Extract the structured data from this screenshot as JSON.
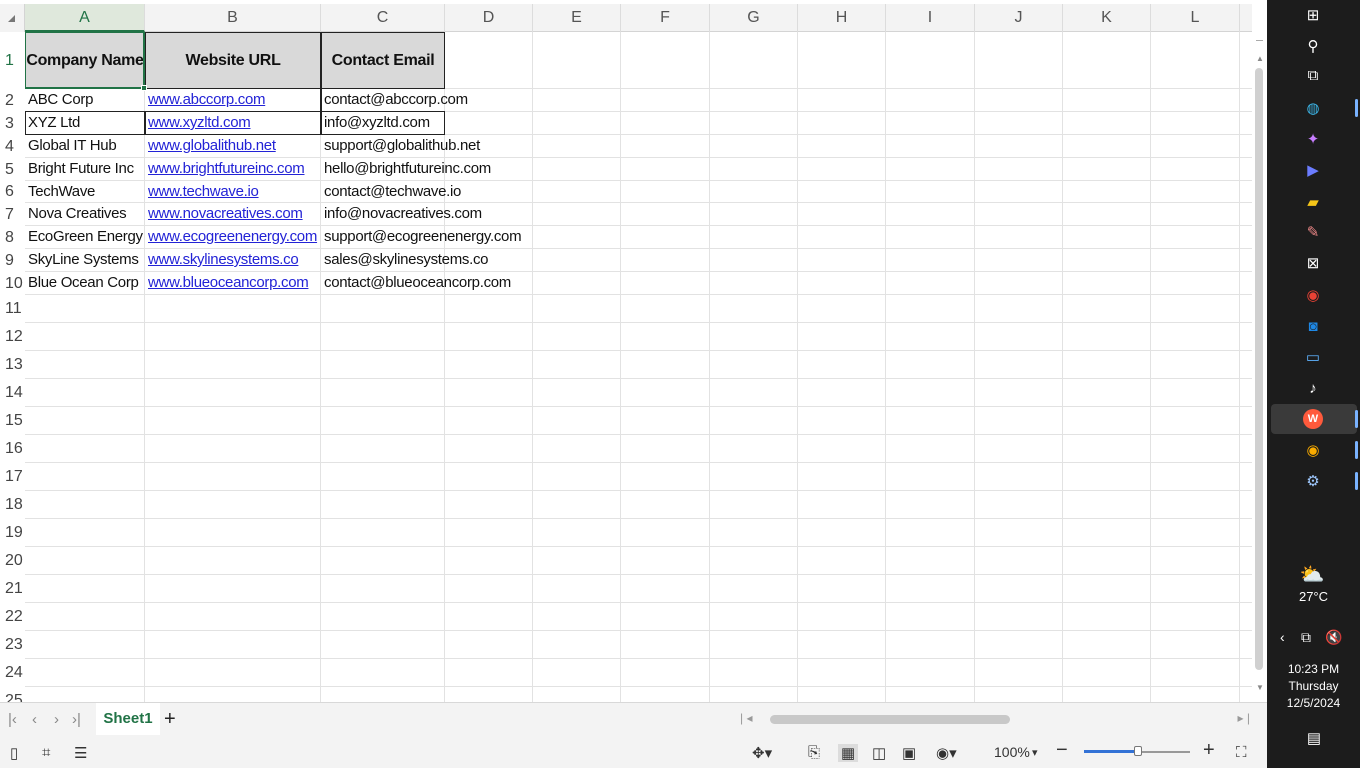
{
  "columns": [
    "A",
    "B",
    "C",
    "D",
    "E",
    "F",
    "G",
    "H",
    "I",
    "J",
    "K",
    "L"
  ],
  "rows": [
    "1",
    "2",
    "3",
    "4",
    "5",
    "6",
    "7",
    "8",
    "9",
    "10",
    "11",
    "12",
    "13",
    "14",
    "15",
    "16",
    "17",
    "18",
    "19",
    "20",
    "21",
    "22",
    "23",
    "24",
    "25"
  ],
  "headers": {
    "company": "Company Name",
    "website": "Website URL",
    "email": "Contact Email"
  },
  "records": [
    {
      "company": "ABC Corp",
      "website": "www.abccorp.com",
      "email": "contact@abccorp.com"
    },
    {
      "company": "XYZ Ltd",
      "website": "www.xyzltd.com",
      "email": "info@xyzltd.com"
    },
    {
      "company": "Global IT Hub",
      "website": "www.globalithub.net",
      "email": "support@globalithub.net"
    },
    {
      "company": "Bright Future Inc",
      "website": "www.brightfutureinc.com",
      "email": "hello@brightfutureinc.com"
    },
    {
      "company": "TechWave",
      "website": "www.techwave.io",
      "email": "contact@techwave.io"
    },
    {
      "company": "Nova Creatives",
      "website": "www.novacreatives.com",
      "email": "info@novacreatives.com"
    },
    {
      "company": "EcoGreen Energy",
      "website": "www.ecogreenenergy.com",
      "email": "support@ecogreenenergy.com"
    },
    {
      "company": "SkyLine Systems",
      "website": "www.skylinesystems.co",
      "email": "sales@skylinesystems.co"
    },
    {
      "company": "Blue Ocean Corp",
      "website": "www.blueoceancorp.com",
      "email": "contact@blueoceancorp.com"
    }
  ],
  "sheet_tab": "Sheet1",
  "add_sheet": "+",
  "zoom": "100%",
  "taskbar": {
    "temperature": "27°C",
    "time": "10:23 PM",
    "day": "Thursday",
    "date": "12/5/2024",
    "icons": [
      "windows-start-icon",
      "search-icon",
      "task-view-icon",
      "edge-icon",
      "copilot-icon",
      "media-player-icon",
      "sticky-notes-icon",
      "paint-icon",
      "capcut-icon",
      "chrome-icon",
      "outlook-icon",
      "remote-desktop-icon",
      "tiktok-icon",
      "wps-office-icon",
      "chrome-profile-icon",
      "steam-icon"
    ]
  },
  "colors": {
    "accent": "#217346",
    "link": "#2323d6",
    "header_fill": "#d9d9d9",
    "taskbar": "#1c1c1c"
  }
}
